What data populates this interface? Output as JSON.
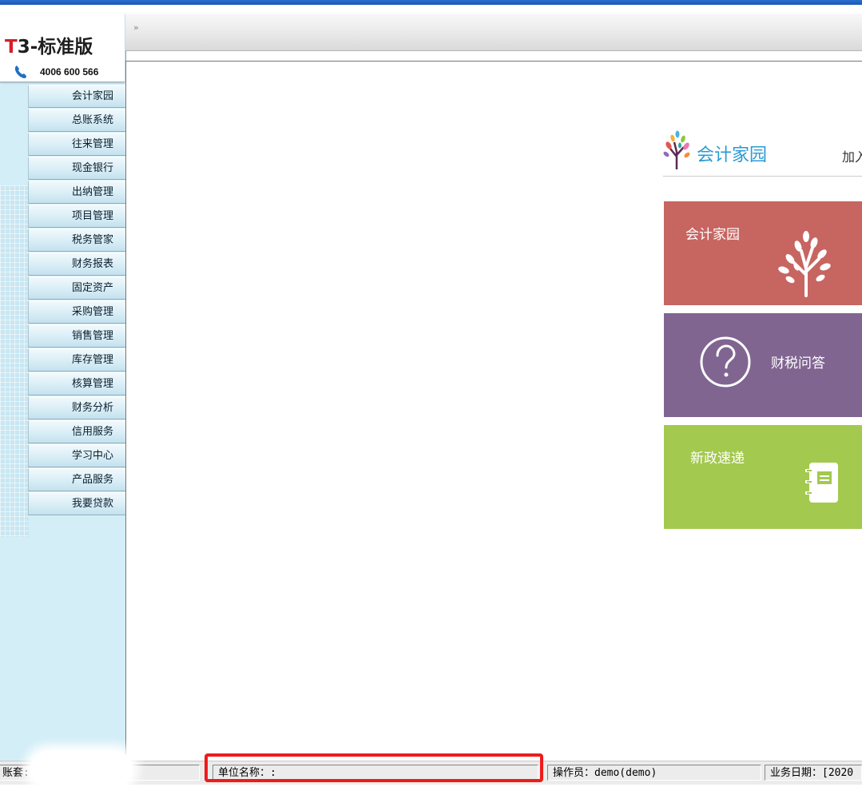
{
  "product": {
    "title_t": "T",
    "title_rest": "3-标准版",
    "hotline": "4006 600 566"
  },
  "toolbar": {
    "expand_glyph": "»"
  },
  "sidebar": {
    "items": [
      {
        "label": "会计家园"
      },
      {
        "label": "总账系统"
      },
      {
        "label": "往来管理"
      },
      {
        "label": "现金银行"
      },
      {
        "label": "出纳管理"
      },
      {
        "label": "项目管理"
      },
      {
        "label": "税务管家"
      },
      {
        "label": "财务报表"
      },
      {
        "label": "固定资产"
      },
      {
        "label": "采购管理"
      },
      {
        "label": "销售管理"
      },
      {
        "label": "库存管理"
      },
      {
        "label": "核算管理"
      },
      {
        "label": "财务分析"
      },
      {
        "label": "信用服务"
      },
      {
        "label": "学习中心"
      },
      {
        "label": "产品服务"
      },
      {
        "label": "我要贷款"
      }
    ]
  },
  "portal": {
    "title": "会计家园",
    "join_text": "加入",
    "tiles": [
      {
        "label": "会计家园",
        "color": "#c76561",
        "icon": "tree-icon"
      },
      {
        "label": "财税问答",
        "color": "#806591",
        "icon": "question-icon"
      },
      {
        "label": "新政速递",
        "color": "#a3c94e",
        "icon": "notebook-icon"
      }
    ]
  },
  "statusbar": {
    "account_label": "账套:",
    "unit_label": "单位名称：:",
    "operator": "操作员：demo(demo)",
    "business_date": "业务日期：[2020"
  },
  "colors": {
    "sidebar_bg": "#d3eef7",
    "highlight_border": "#ee1c1c"
  }
}
